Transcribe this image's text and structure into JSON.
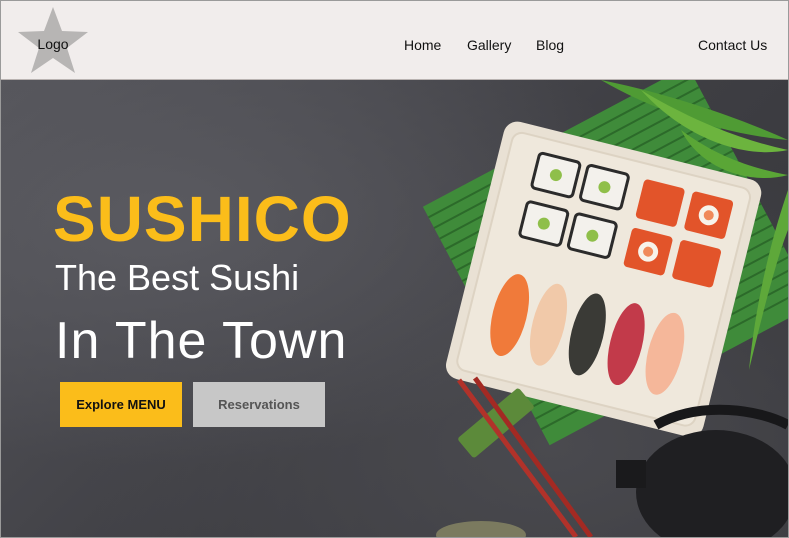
{
  "header": {
    "logo_label": "Logo",
    "nav": {
      "home": "Home",
      "gallery": "Gallery",
      "blog": "Blog",
      "contact": "Contact Us"
    }
  },
  "hero": {
    "brand": "SUSHICO",
    "tagline_line1": "The Best Sushi",
    "tagline_line2": "In The Town",
    "buttons": {
      "explore": "Explore MENU",
      "reservations": "Reservations"
    }
  },
  "colors": {
    "accent": "#fbbd1a",
    "header_bg": "#f1edec",
    "secondary_button": "#c7c7c7",
    "hero_bg": "#444449"
  }
}
